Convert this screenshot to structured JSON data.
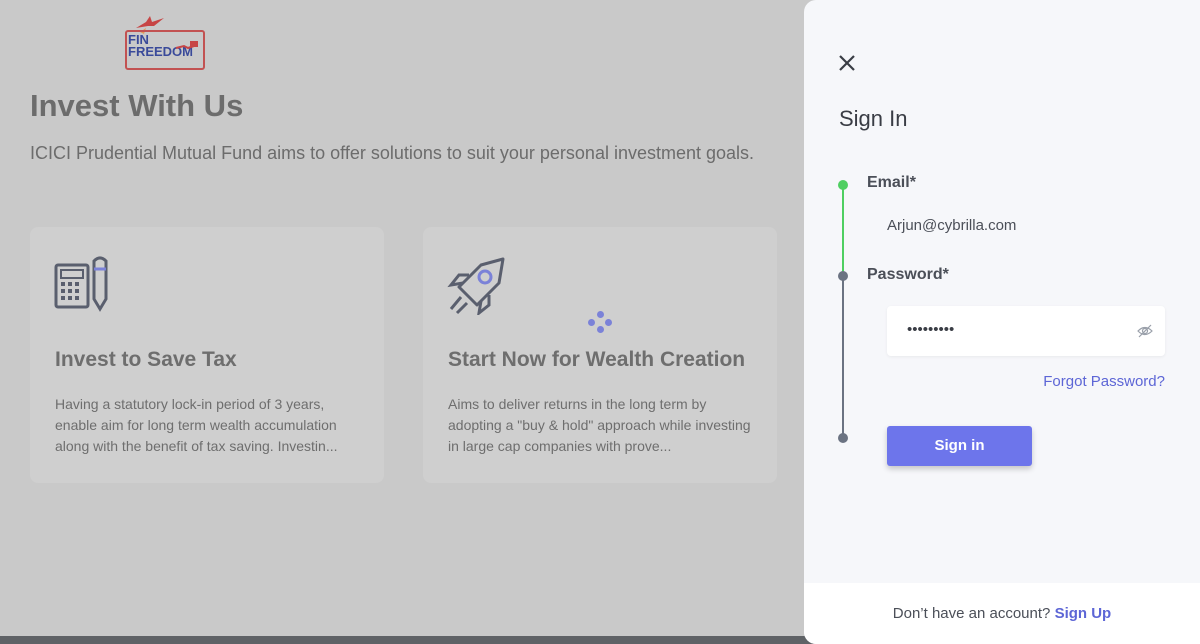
{
  "logo": {
    "line1": "FIN",
    "line2": "FREEDOM"
  },
  "hero": {
    "title": "Invest With Us",
    "subtitle": "ICICI Prudential Mutual Fund aims to offer solutions to suit your personal investment goals."
  },
  "cards": [
    {
      "icon": "calculator-pencil-icon",
      "title": "Invest to Save Tax",
      "description": "Having a statutory lock-in period of 3 years, enable aim for long term wealth accumulation along with the benefit of tax saving. Investin..."
    },
    {
      "icon": "rocket-icon",
      "title": "Start Now for Wealth Creation",
      "description": "Aims to deliver returns in the long term by adopting a \"buy & hold\" approach while investing in large cap companies with prove..."
    }
  ],
  "signin": {
    "title": "Sign In",
    "email_label": "Email*",
    "email_value": "Arjun@cybrilla.com",
    "password_label": "Password*",
    "password_value": "•••••••••",
    "forgot_label": "Forgot Password?",
    "submit_label": "Sign in",
    "footer_text": "Don’t have an account?",
    "signup_label": "Sign Up"
  },
  "colors": {
    "accent": "#6d75eb",
    "link": "#5d66d6",
    "step_done": "#4fcf61",
    "step_pending": "#6b7382"
  }
}
